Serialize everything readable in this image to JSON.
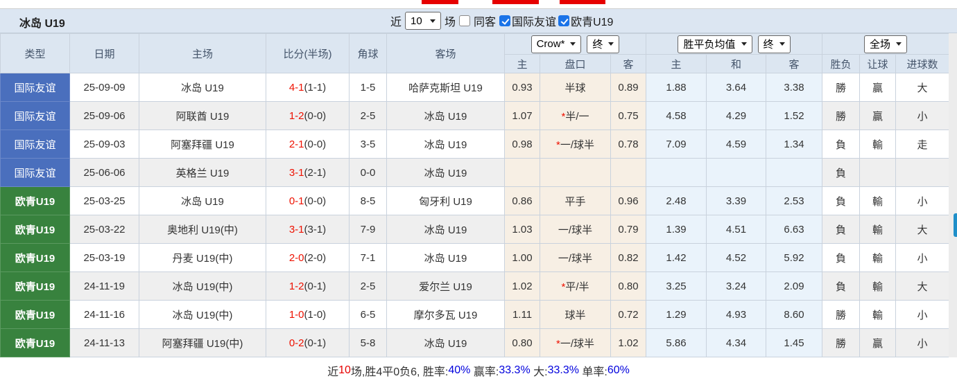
{
  "title": "冰岛 U19",
  "controls": {
    "recent_label": "近",
    "recent_value": "10",
    "matches_label": "场",
    "same_away": {
      "label": "同客",
      "checked": false
    },
    "filter_friendly": {
      "label": "国际友谊",
      "checked": true
    },
    "filter_euro_u19": {
      "label": "欧青U19",
      "checked": true
    }
  },
  "table": {
    "headers": {
      "type": "类型",
      "date": "日期",
      "home": "主场",
      "score": "比分(半场)",
      "corner": "角球",
      "away": "客场"
    },
    "dropdowns": {
      "crow": "Crow*",
      "crow_final": "终",
      "avg": "胜平负均值",
      "avg_final": "终",
      "full": "全场"
    },
    "subheaders": {
      "crow_home": "主",
      "handicap": "盘口",
      "crow_away": "客",
      "avg_home": "主",
      "avg_draw": "和",
      "avg_away": "客",
      "wdl": "胜负",
      "handicap_result": "让球",
      "goals": "进球数"
    },
    "rows": [
      {
        "type": "国际友谊",
        "type_color": "blue",
        "date": "25-09-09",
        "home": "冰岛 U19",
        "home_green": true,
        "score_main": "4-1",
        "score_half": "(1-1)",
        "corner": "1-5",
        "away": "哈萨克斯坦 U19",
        "away_green": false,
        "crow_home": "0.93",
        "handicap": "半球",
        "handicap_star": false,
        "crow_away": "0.89",
        "avg_home": "1.88",
        "avg_draw": "3.64",
        "avg_away": "3.38",
        "wdl": "勝",
        "wdl_color": "red",
        "rang": "贏",
        "rang_color": "red",
        "goals": "大",
        "goals_color": "red"
      },
      {
        "type": "国际友谊",
        "type_color": "blue",
        "date": "25-09-06",
        "home": "阿联酋 U19",
        "home_green": false,
        "score_main": "1-2",
        "score_half": "(0-0)",
        "corner": "2-5",
        "away": "冰岛 U19",
        "away_green": true,
        "crow_home": "1.07",
        "handicap": "半/一",
        "handicap_star": true,
        "crow_away": "0.75",
        "avg_home": "4.58",
        "avg_draw": "4.29",
        "avg_away": "1.52",
        "wdl": "勝",
        "wdl_color": "red",
        "rang": "贏",
        "rang_color": "red",
        "goals": "小",
        "goals_color": "green"
      },
      {
        "type": "国际友谊",
        "type_color": "blue",
        "date": "25-09-03",
        "home": "阿塞拜疆 U19",
        "home_green": false,
        "score_main": "2-1",
        "score_half": "(0-0)",
        "corner": "3-5",
        "away": "冰岛 U19",
        "away_green": true,
        "crow_home": "0.98",
        "handicap": "一/球半",
        "handicap_star": true,
        "crow_away": "0.78",
        "avg_home": "7.09",
        "avg_draw": "4.59",
        "avg_away": "1.34",
        "wdl": "負",
        "wdl_color": "green",
        "rang": "輸",
        "rang_color": "green",
        "goals": "走",
        "goals_color": "blue"
      },
      {
        "type": "国际友谊",
        "type_color": "blue",
        "date": "25-06-06",
        "home": "英格兰 U19",
        "home_green": false,
        "score_main": "3-1",
        "score_half": "(2-1)",
        "corner": "0-0",
        "away": "冰岛 U19",
        "away_green": true,
        "crow_home": "",
        "handicap": "",
        "handicap_star": false,
        "crow_away": "",
        "avg_home": "",
        "avg_draw": "",
        "avg_away": "",
        "wdl": "負",
        "wdl_color": "green",
        "rang": "",
        "rang_color": "green",
        "goals": "",
        "goals_color": "green"
      },
      {
        "type": "欧青U19",
        "type_color": "green",
        "date": "25-03-25",
        "home": "冰岛 U19",
        "home_green": true,
        "score_main": "0-1",
        "score_half": "(0-0)",
        "corner": "8-5",
        "away": "匈牙利 U19",
        "away_green": false,
        "crow_home": "0.86",
        "handicap": "平手",
        "handicap_star": false,
        "crow_away": "0.96",
        "avg_home": "2.48",
        "avg_draw": "3.39",
        "avg_away": "2.53",
        "wdl": "負",
        "wdl_color": "green",
        "rang": "輸",
        "rang_color": "green",
        "goals": "小",
        "goals_color": "green"
      },
      {
        "type": "欧青U19",
        "type_color": "green",
        "date": "25-03-22",
        "home": "奥地利 U19(中)",
        "home_green": false,
        "score_main": "3-1",
        "score_half": "(3-1)",
        "corner": "7-9",
        "away": "冰岛 U19",
        "away_green": true,
        "crow_home": "1.03",
        "handicap": "一/球半",
        "handicap_star": false,
        "crow_away": "0.79",
        "avg_home": "1.39",
        "avg_draw": "4.51",
        "avg_away": "6.63",
        "wdl": "負",
        "wdl_color": "green",
        "rang": "輸",
        "rang_color": "green",
        "goals": "大",
        "goals_color": "red"
      },
      {
        "type": "欧青U19",
        "type_color": "green",
        "date": "25-03-19",
        "home": "丹麦 U19(中)",
        "home_green": false,
        "score_main": "2-0",
        "score_half": "(2-0)",
        "corner": "7-1",
        "away": "冰岛 U19",
        "away_green": true,
        "crow_home": "1.00",
        "handicap": "一/球半",
        "handicap_star": false,
        "crow_away": "0.82",
        "avg_home": "1.42",
        "avg_draw": "4.52",
        "avg_away": "5.92",
        "wdl": "負",
        "wdl_color": "green",
        "rang": "輸",
        "rang_color": "green",
        "goals": "小",
        "goals_color": "green"
      },
      {
        "type": "欧青U19",
        "type_color": "green",
        "date": "24-11-19",
        "home": "冰岛 U19(中)",
        "home_green": true,
        "score_main": "1-2",
        "score_half": "(0-1)",
        "corner": "2-5",
        "away": "爱尔兰 U19",
        "away_green": false,
        "crow_home": "1.02",
        "handicap": "平/半",
        "handicap_star": true,
        "crow_away": "0.80",
        "avg_home": "3.25",
        "avg_draw": "3.24",
        "avg_away": "2.09",
        "wdl": "負",
        "wdl_color": "green",
        "rang": "輸",
        "rang_color": "green",
        "goals": "大",
        "goals_color": "red"
      },
      {
        "type": "欧青U19",
        "type_color": "green",
        "date": "24-11-16",
        "home": "冰岛 U19(中)",
        "home_green": true,
        "score_main": "1-0",
        "score_half": "(1-0)",
        "corner": "6-5",
        "away": "摩尔多瓦 U19",
        "away_green": false,
        "crow_home": "1.11",
        "handicap": "球半",
        "handicap_star": false,
        "crow_away": "0.72",
        "avg_home": "1.29",
        "avg_draw": "4.93",
        "avg_away": "8.60",
        "wdl": "勝",
        "wdl_color": "red",
        "rang": "輸",
        "rang_color": "green",
        "goals": "小",
        "goals_color": "green"
      },
      {
        "type": "欧青U19",
        "type_color": "green",
        "date": "24-11-13",
        "home": "阿塞拜疆 U19(中)",
        "home_green": false,
        "score_main": "0-2",
        "score_half": "(0-1)",
        "corner": "5-8",
        "away": "冰岛 U19",
        "away_green": true,
        "crow_home": "0.80",
        "handicap": "一/球半",
        "handicap_star": true,
        "crow_away": "1.02",
        "avg_home": "5.86",
        "avg_draw": "4.34",
        "avg_away": "1.45",
        "wdl": "勝",
        "wdl_color": "red",
        "rang": "贏",
        "rang_color": "red",
        "goals": "小",
        "goals_color": "green"
      }
    ]
  },
  "summary": {
    "parts": [
      {
        "text": "近",
        "color": "dark"
      },
      {
        "text": "10",
        "color": "red"
      },
      {
        "text": "场,胜4平0负6, 胜率:",
        "color": "dark"
      },
      {
        "text": "40%",
        "color": "blue"
      },
      {
        "text": " 赢率:",
        "color": "dark"
      },
      {
        "text": "33.3%",
        "color": "blue"
      },
      {
        "text": " 大:",
        "color": "dark"
      },
      {
        "text": "33.3%",
        "color": "blue"
      },
      {
        "text": " 单率:",
        "color": "dark"
      },
      {
        "text": "60%",
        "color": "blue"
      }
    ]
  }
}
